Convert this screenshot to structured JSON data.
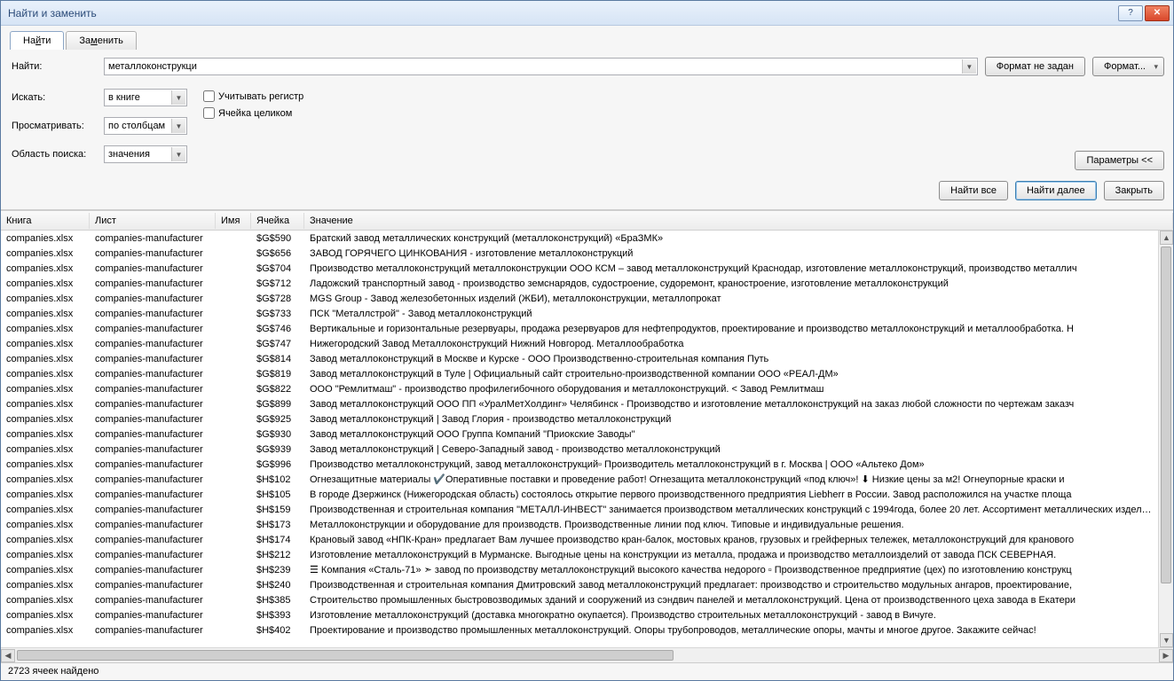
{
  "window": {
    "title": "Найти и заменить"
  },
  "tabs": {
    "find": "Найти",
    "replace": "Заменить",
    "find_u": "й",
    "replace_u": "м"
  },
  "labels": {
    "find": "Найти:",
    "search_in": "Искать:",
    "browse": "Просматривать:",
    "scope": "Область поиска:",
    "findall": "Найти все",
    "findnext": "Найти далее",
    "close": "Закрыть",
    "noformat": "Формат не задан",
    "formatbtn": "Формат...",
    "options": "Параметры <<",
    "matchcase": "Учитывать регистр",
    "wholecell": "Ячейка целиком",
    "matchcase_u": "ч",
    "wholecell_u": "Я",
    "search_in_u": "с",
    "browse_u": "с",
    "find_u": "и",
    "findall_u": "в",
    "findnext_u": "л",
    "close_u": "З",
    "noformat_pre": "Фор",
    "noformat_u": "м",
    "noformat_post": "ат не задан",
    "options_u": "П"
  },
  "find_value": "металлоконструкци",
  "combo": {
    "search_in": "в книге",
    "browse": "по столбцам",
    "scope": "значения"
  },
  "headers": {
    "book": "Книга",
    "sheet": "Лист",
    "name": "Имя",
    "cell": "Ячейка",
    "value": "Значение"
  },
  "status": "2723 ячеек найдено",
  "rows": [
    {
      "book": "companies.xlsx",
      "sheet": "companies-manufacturer",
      "name": "",
      "cell": "$G$590",
      "value": "Братский завод металлических конструкций (металлоконструкций) «БраЗМК»"
    },
    {
      "book": "companies.xlsx",
      "sheet": "companies-manufacturer",
      "name": "",
      "cell": "$G$656",
      "value": "ЗАВОД ГОРЯЧЕГО ЦИНКОВАНИЯ - изготовление металлоконструкций"
    },
    {
      "book": "companies.xlsx",
      "sheet": "companies-manufacturer",
      "name": "",
      "cell": "$G$704",
      "value": "Производство металлоконструкций металлоконструкции ООО КСМ – завод металлоконструкций Краснодар, изготовление металлоконструкций, производство металлич"
    },
    {
      "book": "companies.xlsx",
      "sheet": "companies-manufacturer",
      "name": "",
      "cell": "$G$712",
      "value": "Ладожский транспортный завод - производство земснарядов, судостроение, судоремонт, краностроение, изготовление металлоконструкций"
    },
    {
      "book": "companies.xlsx",
      "sheet": "companies-manufacturer",
      "name": "",
      "cell": "$G$728",
      "value": "MGS Group - Завод железобетонных изделий (ЖБИ), металлоконструкции, металлопрокат"
    },
    {
      "book": "companies.xlsx",
      "sheet": "companies-manufacturer",
      "name": "",
      "cell": "$G$733",
      "value": "ПСК \"Металлстрой\" - Завод металлоконструкций"
    },
    {
      "book": "companies.xlsx",
      "sheet": "companies-manufacturer",
      "name": "",
      "cell": "$G$746",
      "value": "Вертикальные и горизонтальные резервуары, продажа резервуаров для нефтепродуктов, проектирование и производство металлоконструкций и металлообработка. Н"
    },
    {
      "book": "companies.xlsx",
      "sheet": "companies-manufacturer",
      "name": "",
      "cell": "$G$747",
      "value": "Нижегородский Завод Металлоконструкций Нижний Новгород. Металлообработка"
    },
    {
      "book": "companies.xlsx",
      "sheet": "companies-manufacturer",
      "name": "",
      "cell": "$G$814",
      "value": "Завод металлоконструкций в Москве и Курске - ООО Производственно-строительная компания Путь"
    },
    {
      "book": "companies.xlsx",
      "sheet": "companies-manufacturer",
      "name": "",
      "cell": "$G$819",
      "value": "Завод металлоконструкций в Туле | Официальный сайт строительно-производственной компании ООО «РЕАЛ-ДМ»"
    },
    {
      "book": "companies.xlsx",
      "sheet": "companies-manufacturer",
      "name": "",
      "cell": "$G$822",
      "value": "ООО \"Ремлитмаш\" - производство профилегибочного оборудования и металлоконструкций. < Завод Ремлитмаш"
    },
    {
      "book": "companies.xlsx",
      "sheet": "companies-manufacturer",
      "name": "",
      "cell": "$G$899",
      "value": "Завод металлоконструкций ООО ПП «УралМетХолдинг» Челябинск - Производство и изготовление металлоконструкций на заказ любой сложности по чертежам заказч"
    },
    {
      "book": "companies.xlsx",
      "sheet": "companies-manufacturer",
      "name": "",
      "cell": "$G$925",
      "value": "Завод металлоконструкций | Завод Глория - производство металлоконструкций"
    },
    {
      "book": "companies.xlsx",
      "sheet": "companies-manufacturer",
      "name": "",
      "cell": "$G$930",
      "value": "Завод металлоконструкций ООО Группа Компаний \"Приокские Заводы\""
    },
    {
      "book": "companies.xlsx",
      "sheet": "companies-manufacturer",
      "name": "",
      "cell": "$G$939",
      "value": "Завод металлоконструкций | Северо-Западный завод - производство металлоконструкций"
    },
    {
      "book": "companies.xlsx",
      "sheet": "companies-manufacturer",
      "name": "",
      "cell": "$G$996",
      "value": "Производство металлоконструкций, завод металлоконструкций▫ Производитель металлоконструкций в г. Москва | ООО «Альтеко Дом»"
    },
    {
      "book": "companies.xlsx",
      "sheet": "companies-manufacturer",
      "name": "",
      "cell": "$H$102",
      "value": "Огнезащитные материалы ✔️Оперативные поставки и проведение работ! Огнезащита металлоконструкций «под ключ»! ⬇ Низкие цены за м2! Огнеупорные краски и"
    },
    {
      "book": "companies.xlsx",
      "sheet": "companies-manufacturer",
      "name": "",
      "cell": "$H$105",
      "value": "В городе Дзержинск (Нижегородская область) состоялось открытие первого производственного предприятия Liebherr в России. Завод расположился на участке площа"
    },
    {
      "book": "companies.xlsx",
      "sheet": "companies-manufacturer",
      "name": "",
      "cell": "$H$159",
      "value": "Производственная и строительная компания \"МЕТАЛЛ-ИНВЕСТ\" занимается производством металлических конструкций с 1994года, более 20 лет. Ассортимент металлических изделий сост"
    },
    {
      "book": "companies.xlsx",
      "sheet": "companies-manufacturer",
      "name": "",
      "cell": "$H$173",
      "value": "Металлоконструкции и оборудование для производств. Производственные линии под ключ. Типовые и индивидуальные решения."
    },
    {
      "book": "companies.xlsx",
      "sheet": "companies-manufacturer",
      "name": "",
      "cell": "$H$174",
      "value": "Крановый завод «НПК-Кран» предлагает Вам лучшее производство кран-балок, мостовых кранов, грузовых и грейферных тележек, металлоконструкций для кранового"
    },
    {
      "book": "companies.xlsx",
      "sheet": "companies-manufacturer",
      "name": "",
      "cell": "$H$212",
      "value": "Изготовление металлоконструкций в Мурманске. Выгодные цены на конструкции из металла, продажа и производство металлоизделий от завода ПСК СЕВЕРНАЯ."
    },
    {
      "book": "companies.xlsx",
      "sheet": "companies-manufacturer",
      "name": "",
      "cell": "$H$239",
      "value": "☰ Компания «Сталь-71» ➣ завод по производству металлоконструкций высокого качества недорого ▫ Производственное предприятие (цех) по изготовлению конструкц"
    },
    {
      "book": "companies.xlsx",
      "sheet": "companies-manufacturer",
      "name": "",
      "cell": "$H$240",
      "value": "Производственная и строительная компания Дмитровский завод металлоконструкций предлагает: производство и строительство модульных ангаров, проектирование,"
    },
    {
      "book": "companies.xlsx",
      "sheet": "companies-manufacturer",
      "name": "",
      "cell": "$H$385",
      "value": "Строительство промышленных быстровозводимых зданий и сооружений из сэндвич панелей и металлоконструкций. Цена от производственного цеха завода в Екатери"
    },
    {
      "book": "companies.xlsx",
      "sheet": "companies-manufacturer",
      "name": "",
      "cell": "$H$393",
      "value": "Изготовление металлоконструкций (доставка многократно окупается). Производство строительных металлоконструкций - завод в Вичуге."
    },
    {
      "book": "companies.xlsx",
      "sheet": "companies-manufacturer",
      "name": "",
      "cell": "$H$402",
      "value": "Проектирование и производство промышленных металлоконструкций. Опоры трубопроводов, металлические опоры, мачты и многое другое. Закажите сейчас!"
    }
  ]
}
